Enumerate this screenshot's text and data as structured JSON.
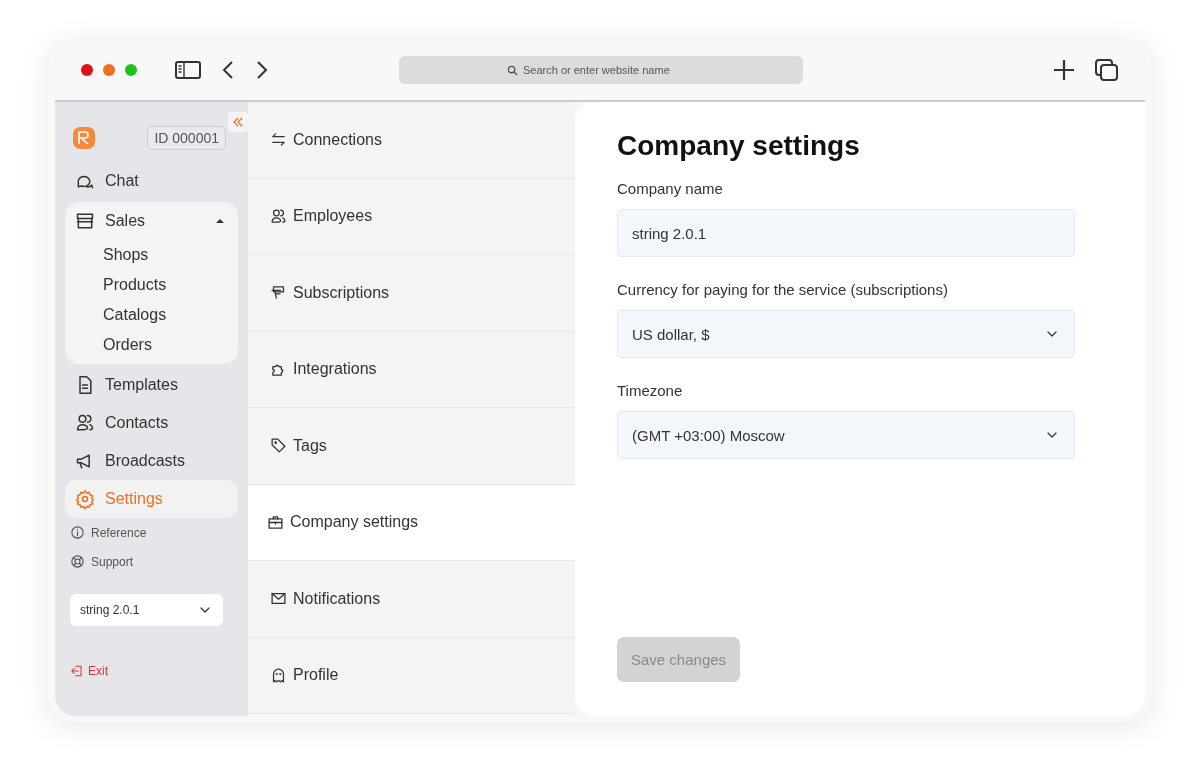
{
  "browser": {
    "search_placeholder": "Search or enter website name"
  },
  "sidebar": {
    "account_id": "ID 000001",
    "collapsed": false,
    "items": [
      {
        "label": "Chat",
        "selected": false
      },
      {
        "label": "Sales",
        "selected": false,
        "expanded": true,
        "children": [
          {
            "label": "Shops"
          },
          {
            "label": "Products"
          },
          {
            "label": "Catalogs"
          },
          {
            "label": "Orders"
          }
        ]
      },
      {
        "label": "Templates",
        "selected": false
      },
      {
        "label": "Contacts",
        "selected": false
      },
      {
        "label": "Broadcasts",
        "selected": false
      },
      {
        "label": "Settings",
        "selected": true
      }
    ],
    "links": [
      {
        "label": "Reference"
      },
      {
        "label": "Support"
      }
    ],
    "version_select": "string 2.0.1",
    "exit": "Exit"
  },
  "settings_menu": [
    {
      "label": "Connections",
      "selected": false
    },
    {
      "label": "Employees",
      "selected": false
    },
    {
      "label": "Subscriptions",
      "selected": false
    },
    {
      "label": "Integrations",
      "selected": false
    },
    {
      "label": "Tags",
      "selected": false
    },
    {
      "label": "Company settings",
      "selected": true
    },
    {
      "label": "Notifications",
      "selected": false
    },
    {
      "label": "Profile",
      "selected": false
    }
  ],
  "content": {
    "title": "Company settings",
    "fields": [
      {
        "kind": "text",
        "label": "Company name",
        "value": "string 2.0.1"
      },
      {
        "kind": "select",
        "label": "Currency for paying for the service (subscriptions)",
        "value": "US dollar, $"
      },
      {
        "kind": "select",
        "label": "Timezone",
        "value": "(GMT +03:00) Moscow"
      }
    ],
    "save_button": {
      "label": "Save changes",
      "disabled": true
    }
  }
}
